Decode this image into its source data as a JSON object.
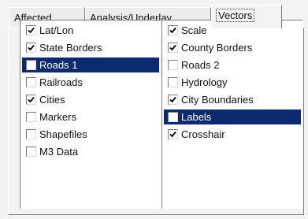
{
  "tabs": [
    {
      "label": "Affected",
      "active": false
    },
    {
      "label": "Analysis/Underlay",
      "active": false
    },
    {
      "label": "Vectors",
      "active": true
    }
  ],
  "left_list": [
    {
      "label": "Lat/Lon",
      "checked": true,
      "selected": false
    },
    {
      "label": "State Borders",
      "checked": true,
      "selected": false
    },
    {
      "label": "Roads 1",
      "checked": false,
      "selected": true
    },
    {
      "label": "Railroads",
      "checked": false,
      "selected": false
    },
    {
      "label": "Cities",
      "checked": true,
      "selected": false
    },
    {
      "label": "Markers",
      "checked": false,
      "selected": false
    },
    {
      "label": "Shapefiles",
      "checked": false,
      "selected": false
    },
    {
      "label": "M3 Data",
      "checked": false,
      "selected": false
    }
  ],
  "right_list": [
    {
      "label": "Scale",
      "checked": true,
      "selected": false
    },
    {
      "label": "County Borders",
      "checked": true,
      "selected": false
    },
    {
      "label": "Roads 2",
      "checked": false,
      "selected": false
    },
    {
      "label": "Hydrology",
      "checked": false,
      "selected": false
    },
    {
      "label": "City Boundaries",
      "checked": true,
      "selected": false
    },
    {
      "label": "Labels",
      "checked": false,
      "selected": true
    },
    {
      "label": "Crosshair",
      "checked": true,
      "selected": false
    }
  ],
  "colors": {
    "selection": "#0b2a6f",
    "panel_bg": "#f3f3f3",
    "list_bg": "#ffffff"
  }
}
